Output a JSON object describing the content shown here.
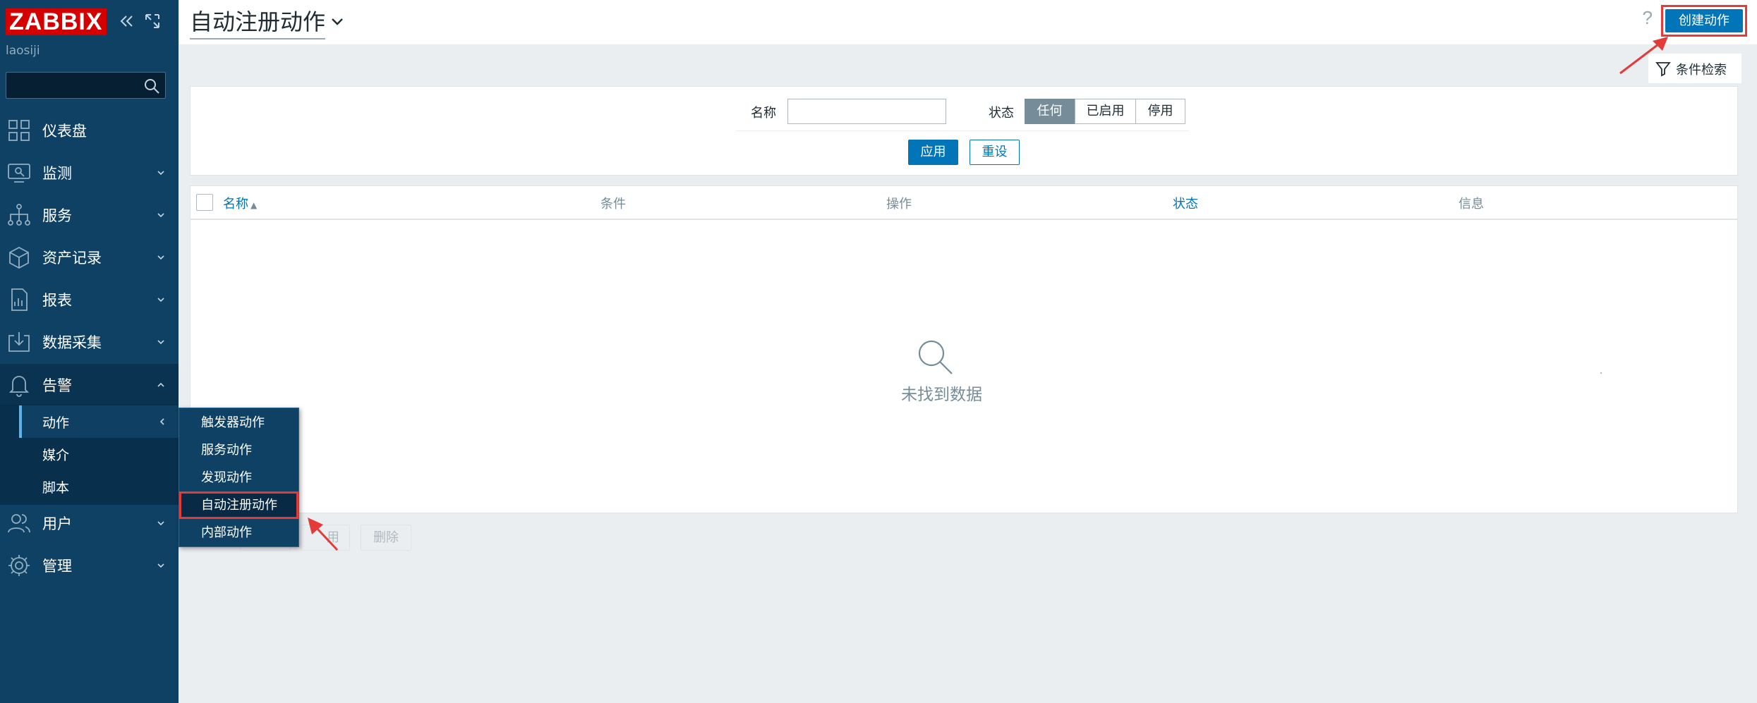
{
  "app": {
    "logo_text": "ZABBIX",
    "username": "laosiji",
    "collapse_icon": "double-chevron-left-icon",
    "kiosk_icon": "expand-icon"
  },
  "sidebar": {
    "search_placeholder": "",
    "items": [
      {
        "label": "仪表盘",
        "icon": "dashboard-icon"
      },
      {
        "label": "监测",
        "icon": "monitoring-icon"
      },
      {
        "label": "服务",
        "icon": "services-icon"
      },
      {
        "label": "资产记录",
        "icon": "inventory-icon"
      },
      {
        "label": "报表",
        "icon": "reports-icon"
      },
      {
        "label": "数据采集",
        "icon": "data-collection-icon"
      },
      {
        "label": "告警",
        "icon": "bell-icon"
      },
      {
        "label": "用户",
        "icon": "users-icon"
      },
      {
        "label": "管理",
        "icon": "gear-icon"
      }
    ],
    "alerts_submenu": [
      {
        "label": "动作"
      },
      {
        "label": "媒介"
      },
      {
        "label": "脚本"
      }
    ]
  },
  "flyout": {
    "items": [
      {
        "label": "触发器动作"
      },
      {
        "label": "服务动作"
      },
      {
        "label": "发现动作"
      },
      {
        "label": "自动注册动作"
      },
      {
        "label": "内部动作"
      }
    ]
  },
  "header": {
    "title": "自动注册动作",
    "help": "?",
    "create_button": "创建动作"
  },
  "filter": {
    "tab_label": "条件检索",
    "name_label": "名称",
    "name_value": "",
    "status_label": "状态",
    "status_options": [
      "任何",
      "已启用",
      "停用"
    ],
    "status_selected": "任何",
    "apply_button": "应用",
    "reset_button": "重设"
  },
  "table": {
    "columns": [
      "名称",
      "条件",
      "操作",
      "状态",
      "信息"
    ],
    "sorted_by": "名称",
    "sort_direction": "▲",
    "rows": [],
    "empty_message": "未找到数据"
  },
  "mass_actions": {
    "disable_partial": "用",
    "delete": "删除"
  },
  "colors": {
    "sidebar_bg": "#0e4164",
    "accent_blue": "#0275b8",
    "logo_red": "#d40000",
    "annotation_red": "#e33a3a"
  }
}
